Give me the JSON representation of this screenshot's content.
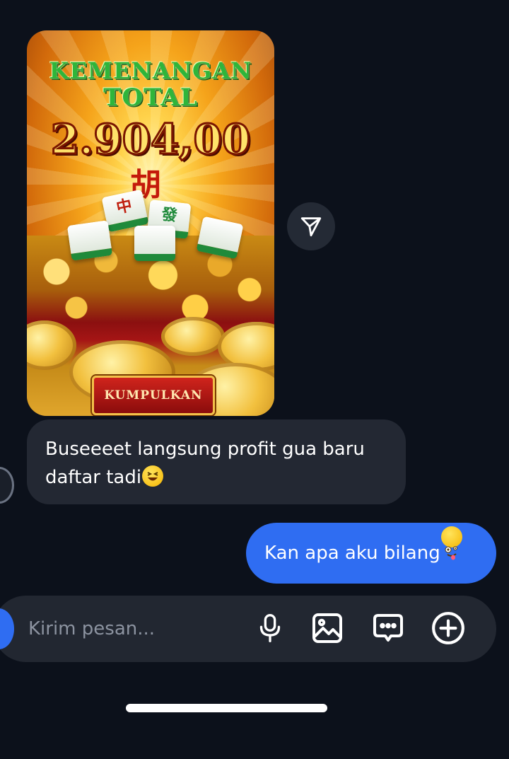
{
  "media": {
    "title_line1": "KEMENANGAN",
    "title_line2": "TOTAL",
    "amount": "2.904,00",
    "glyph": "胡",
    "collect_label": "KUMPULKAN",
    "tiles": [
      "中",
      "發",
      "",
      "",
      ""
    ]
  },
  "messages": {
    "received": {
      "text": "Buseeeet langsung profit gua baru daftar tadi",
      "emoji": "laughing-emoji"
    },
    "sent": {
      "text": "Kan apa aku bilang",
      "emoji": "zany-face-emoji"
    }
  },
  "composer": {
    "placeholder": "Kirim pesan..."
  },
  "colors": {
    "background": "#0c111b",
    "received_bubble": "#232833",
    "sent_bubble": "#2f6df2",
    "composer": "#222731"
  }
}
